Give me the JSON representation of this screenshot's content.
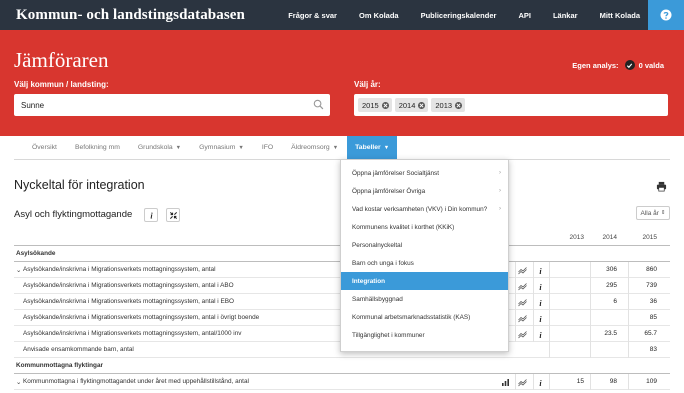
{
  "topnav": {
    "brand": "Kommun- och landstingsdatabasen",
    "links": [
      "Frågor & svar",
      "Om Kolada",
      "Publiceringskalender",
      "API",
      "Länkar",
      "Mitt Kolada"
    ],
    "help_icon": "question-icon"
  },
  "header": {
    "title": "Jämföraren",
    "analysis_label": "Egen analys:",
    "analysis_value": "0 valda",
    "municipality_label": "Välj kommun / landsting:",
    "municipality_value": "Sunne",
    "year_label": "Välj år:",
    "years": [
      "2015",
      "2014",
      "2013"
    ]
  },
  "tabs": [
    "Översikt",
    "Befolkning mm",
    "Grundskola",
    "Gymnasium",
    "IFO",
    "Äldreomsorg",
    "Tabeller"
  ],
  "content": {
    "page_title": "Nyckeltal för integration",
    "section_title": "Asyl och flyktingmottagande",
    "all_years_label": "Alla år",
    "year_headers": [
      "2013",
      "2014",
      "2015"
    ]
  },
  "table": {
    "groups": [
      {
        "name": "Asylsökande",
        "rows": [
          {
            "label": "Asylsökande/inskrivna i Migrationsverkets mottagningssystem, antal",
            "values": [
              "",
              "306",
              "860"
            ],
            "expanded": true
          },
          {
            "label": "Asylsökande/inskrivna i Migrationsverkets mottagningssystem, antal i ABO",
            "values": [
              "",
              "295",
              "739"
            ]
          },
          {
            "label": "Asylsökande/inskrivna i Migrationsverkets mottagningssystem, antal i EBO",
            "values": [
              "",
              "6",
              "36"
            ]
          },
          {
            "label": "Asylsökande/inskrivna i Migrationsverkets mottagningssystem, antal i övrigt boende",
            "values": [
              "",
              "",
              "85"
            ]
          },
          {
            "label": "Asylsökande/inskrivna i Migrationsverkets mottagningssystem, antal/1000 inv",
            "values": [
              "",
              "23.5",
              "65.7"
            ]
          },
          {
            "label": "Anvisade ensamkommande barn, antal",
            "values": [
              "",
              "",
              "83"
            ]
          }
        ]
      },
      {
        "name": "Kommunmottagna flyktingar",
        "rows": [
          {
            "label": "Kommunmottagna i flyktingmottagandet under året med uppehållstillstånd, antal",
            "values": [
              "15",
              "98",
              "109"
            ],
            "expanded": true
          }
        ]
      }
    ]
  },
  "dropdown": {
    "items": [
      {
        "label": "Öppna jämförelser Socialtjänst",
        "submenu": true
      },
      {
        "label": "Öppna jämförelser Övriga",
        "submenu": true
      },
      {
        "label": "Vad kostar verksamheten (VKV) i Din kommun?",
        "submenu": true
      },
      {
        "label": "Kommunens kvalitet i korthet (KKiK)",
        "submenu": false
      },
      {
        "label": "Personalnyckeltal",
        "submenu": false
      },
      {
        "label": "Barn och unga i fokus",
        "submenu": false
      },
      {
        "label": "Integration",
        "submenu": false,
        "selected": true
      },
      {
        "label": "Samhällsbyggnad",
        "submenu": false
      },
      {
        "label": "Kommunal arbetsmarknadsstatistik (KAS)",
        "submenu": false
      },
      {
        "label": "Tillgänglighet i kommuner",
        "submenu": false
      }
    ]
  },
  "colors": {
    "topnav_bg": "#2b3440",
    "hero_red": "#d8362f",
    "accent_blue": "#3b9ad9"
  }
}
